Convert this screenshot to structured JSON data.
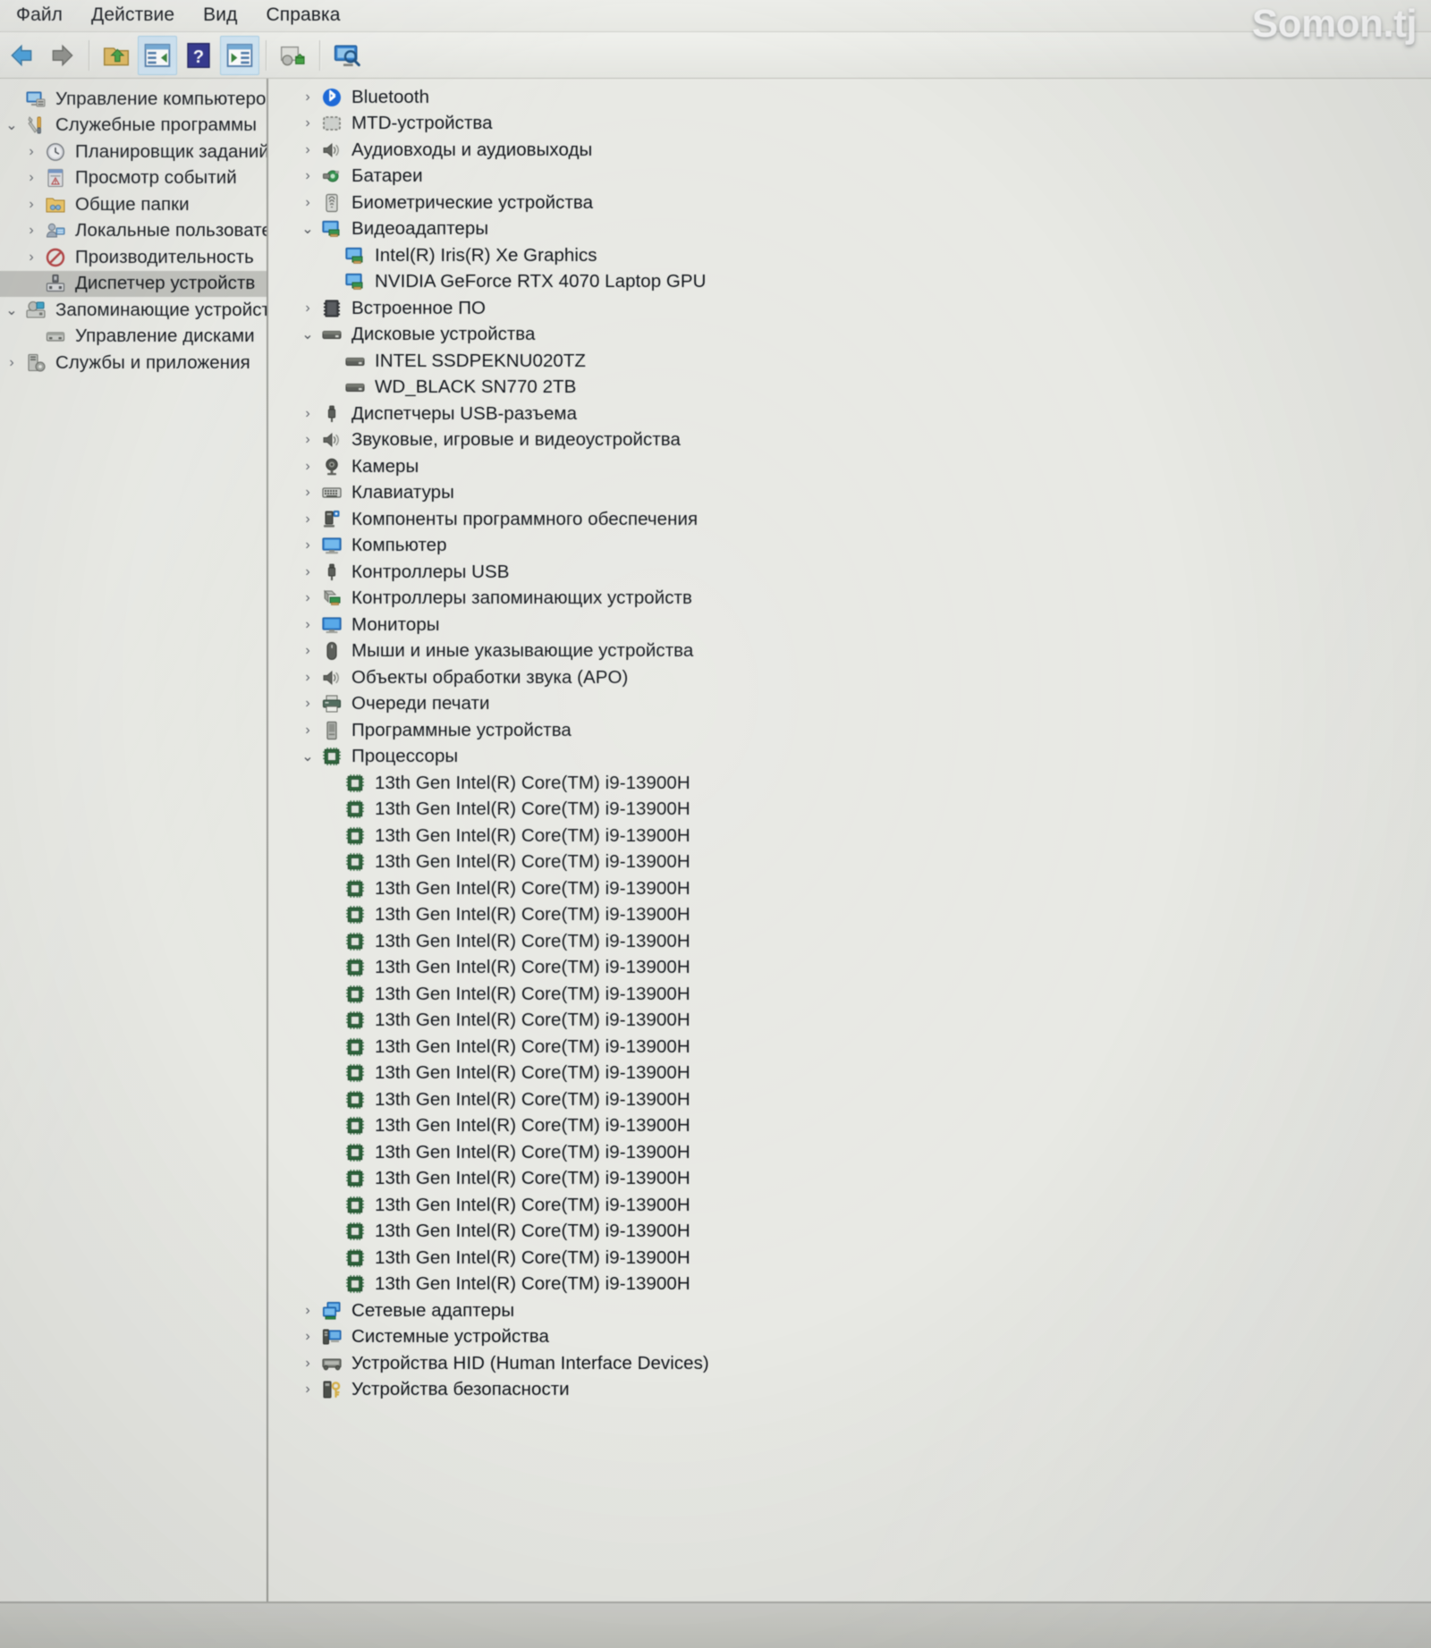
{
  "watermark": "Somon.tj",
  "menubar": {
    "items": [
      {
        "label": "Файл",
        "name": "menu-file"
      },
      {
        "label": "Действие",
        "name": "menu-action"
      },
      {
        "label": "Вид",
        "name": "menu-view"
      },
      {
        "label": "Справка",
        "name": "menu-help"
      }
    ]
  },
  "toolbar": {
    "buttons": [
      {
        "name": "back-button",
        "icon": "arrow-left-icon",
        "active": false
      },
      {
        "name": "forward-button",
        "icon": "arrow-right-icon",
        "active": false
      },
      {
        "name": "up-folder-button",
        "icon": "folder-up-icon",
        "active": false
      },
      {
        "name": "show-hide-console-tree-button",
        "icon": "console-tree-icon",
        "active": true
      },
      {
        "name": "help-button",
        "icon": "question-mark-icon",
        "active": false
      },
      {
        "name": "show-hide-action-pane-button",
        "icon": "action-pane-icon",
        "active": true
      },
      {
        "name": "update-driver-button",
        "icon": "driver-update-icon",
        "active": false
      },
      {
        "name": "scan-hardware-changes-button",
        "icon": "scan-monitor-icon",
        "active": false
      }
    ]
  },
  "sidebar": {
    "items": [
      {
        "label": "Управление компьютером (лс",
        "indent": 0,
        "chevron": "none",
        "icon": "computer-management-icon",
        "selected": false,
        "name": "sidebar-item-computer-management"
      },
      {
        "label": "Служебные программы",
        "indent": 0,
        "chevron": "open",
        "icon": "system-tools-icon",
        "selected": false,
        "name": "sidebar-item-system-tools"
      },
      {
        "label": "Планировщик заданий",
        "indent": 1,
        "chevron": "closed",
        "icon": "task-scheduler-icon",
        "selected": false,
        "name": "sidebar-item-task-scheduler"
      },
      {
        "label": "Просмотр событий",
        "indent": 1,
        "chevron": "closed",
        "icon": "event-viewer-icon",
        "selected": false,
        "name": "sidebar-item-event-viewer"
      },
      {
        "label": "Общие папки",
        "indent": 1,
        "chevron": "closed",
        "icon": "shared-folders-icon",
        "selected": false,
        "name": "sidebar-item-shared-folders"
      },
      {
        "label": "Локальные пользовате",
        "indent": 1,
        "chevron": "closed",
        "icon": "local-users-icon",
        "selected": false,
        "name": "sidebar-item-local-users-groups"
      },
      {
        "label": "Производительность",
        "indent": 1,
        "chevron": "closed",
        "icon": "performance-icon",
        "selected": false,
        "name": "sidebar-item-performance"
      },
      {
        "label": "Диспетчер устройств",
        "indent": 1,
        "chevron": "none",
        "icon": "device-manager-icon",
        "selected": true,
        "name": "sidebar-item-device-manager"
      },
      {
        "label": "Запоминающие устройств",
        "indent": 0,
        "chevron": "open",
        "icon": "storage-icon",
        "selected": false,
        "name": "sidebar-item-storage"
      },
      {
        "label": "Управление дисками",
        "indent": 1,
        "chevron": "none",
        "icon": "disk-management-icon",
        "selected": false,
        "name": "sidebar-item-disk-management"
      },
      {
        "label": "Службы и приложения",
        "indent": 0,
        "chevron": "closed",
        "icon": "services-apps-icon",
        "selected": false,
        "name": "sidebar-item-services-applications"
      }
    ]
  },
  "device_tree": {
    "items": [
      {
        "label": "Bluetooth",
        "indent": 1,
        "chevron": "closed",
        "icon": "bluetooth-icon",
        "name": "device-node-bluetooth"
      },
      {
        "label": "MTD-устройства",
        "indent": 1,
        "chevron": "closed",
        "icon": "mtd-device-icon",
        "name": "device-node-mtd"
      },
      {
        "label": "Аудиовходы и аудиовыходы",
        "indent": 1,
        "chevron": "closed",
        "icon": "speaker-icon",
        "name": "device-node-audio-inputs-outputs"
      },
      {
        "label": "Батареи",
        "indent": 1,
        "chevron": "closed",
        "icon": "battery-icon",
        "name": "device-node-batteries"
      },
      {
        "label": "Биометрические устройства",
        "indent": 1,
        "chevron": "closed",
        "icon": "fingerprint-icon",
        "name": "device-node-biometric"
      },
      {
        "label": "Видеоадаптеры",
        "indent": 1,
        "chevron": "open",
        "icon": "display-adapter-icon",
        "name": "device-node-display-adapters"
      },
      {
        "label": "Intel(R) Iris(R) Xe Graphics",
        "indent": 2,
        "chevron": "none",
        "icon": "display-adapter-icon",
        "name": "device-leaf-intel-iris-xe"
      },
      {
        "label": "NVIDIA GeForce RTX 4070 Laptop GPU",
        "indent": 2,
        "chevron": "none",
        "icon": "display-adapter-icon",
        "name": "device-leaf-nvidia-rtx-4070"
      },
      {
        "label": "Встроенное ПО",
        "indent": 1,
        "chevron": "closed",
        "icon": "firmware-icon",
        "name": "device-node-firmware"
      },
      {
        "label": "Дисковые устройства",
        "indent": 1,
        "chevron": "open",
        "icon": "disk-drive-icon",
        "name": "device-node-disk-drives"
      },
      {
        "label": "INTEL SSDPEKNU020TZ",
        "indent": 2,
        "chevron": "none",
        "icon": "disk-drive-icon",
        "name": "device-leaf-intel-ssd"
      },
      {
        "label": "WD_BLACK SN770 2TB",
        "indent": 2,
        "chevron": "none",
        "icon": "disk-drive-icon",
        "name": "device-leaf-wd-black-sn770"
      },
      {
        "label": "Диспетчеры USB-разъема",
        "indent": 1,
        "chevron": "closed",
        "icon": "usb-connector-icon",
        "name": "device-node-usb-connector-managers"
      },
      {
        "label": "Звуковые, игровые и видеоустройства",
        "indent": 1,
        "chevron": "closed",
        "icon": "speaker-icon",
        "name": "device-node-sound-video-game"
      },
      {
        "label": "Камеры",
        "indent": 1,
        "chevron": "closed",
        "icon": "camera-icon",
        "name": "device-node-cameras"
      },
      {
        "label": "Клавиатуры",
        "indent": 1,
        "chevron": "closed",
        "icon": "keyboard-icon",
        "name": "device-node-keyboards"
      },
      {
        "label": "Компоненты программного обеспечения",
        "indent": 1,
        "chevron": "closed",
        "icon": "software-component-icon",
        "name": "device-node-software-components"
      },
      {
        "label": "Компьютер",
        "indent": 1,
        "chevron": "closed",
        "icon": "computer-icon",
        "name": "device-node-computer"
      },
      {
        "label": "Контроллеры USB",
        "indent": 1,
        "chevron": "closed",
        "icon": "usb-connector-icon",
        "name": "device-node-usb-controllers"
      },
      {
        "label": "Контроллеры запоминающих устройств",
        "indent": 1,
        "chevron": "closed",
        "icon": "storage-controller-icon",
        "name": "device-node-storage-controllers"
      },
      {
        "label": "Мониторы",
        "indent": 1,
        "chevron": "closed",
        "icon": "monitor-icon",
        "name": "device-node-monitors"
      },
      {
        "label": "Мыши и иные указывающие устройства",
        "indent": 1,
        "chevron": "closed",
        "icon": "mouse-icon",
        "name": "device-node-mice-pointing"
      },
      {
        "label": "Объекты обработки звука (APO)",
        "indent": 1,
        "chevron": "closed",
        "icon": "speaker-icon",
        "name": "device-node-audio-processing-objects"
      },
      {
        "label": "Очереди печати",
        "indent": 1,
        "chevron": "closed",
        "icon": "printer-icon",
        "name": "device-node-print-queues"
      },
      {
        "label": "Программные устройства",
        "indent": 1,
        "chevron": "closed",
        "icon": "software-device-icon",
        "name": "device-node-software-devices"
      },
      {
        "label": "Процессоры",
        "indent": 1,
        "chevron": "open",
        "icon": "processor-icon",
        "name": "device-node-processors"
      },
      {
        "label": "13th Gen Intel(R) Core(TM) i9-13900H",
        "indent": 2,
        "chevron": "none",
        "icon": "processor-icon",
        "name": "device-leaf-cpu-1"
      },
      {
        "label": "13th Gen Intel(R) Core(TM) i9-13900H",
        "indent": 2,
        "chevron": "none",
        "icon": "processor-icon",
        "name": "device-leaf-cpu-2"
      },
      {
        "label": "13th Gen Intel(R) Core(TM) i9-13900H",
        "indent": 2,
        "chevron": "none",
        "icon": "processor-icon",
        "name": "device-leaf-cpu-3"
      },
      {
        "label": "13th Gen Intel(R) Core(TM) i9-13900H",
        "indent": 2,
        "chevron": "none",
        "icon": "processor-icon",
        "name": "device-leaf-cpu-4"
      },
      {
        "label": "13th Gen Intel(R) Core(TM) i9-13900H",
        "indent": 2,
        "chevron": "none",
        "icon": "processor-icon",
        "name": "device-leaf-cpu-5"
      },
      {
        "label": "13th Gen Intel(R) Core(TM) i9-13900H",
        "indent": 2,
        "chevron": "none",
        "icon": "processor-icon",
        "name": "device-leaf-cpu-6"
      },
      {
        "label": "13th Gen Intel(R) Core(TM) i9-13900H",
        "indent": 2,
        "chevron": "none",
        "icon": "processor-icon",
        "name": "device-leaf-cpu-7"
      },
      {
        "label": "13th Gen Intel(R) Core(TM) i9-13900H",
        "indent": 2,
        "chevron": "none",
        "icon": "processor-icon",
        "name": "device-leaf-cpu-8"
      },
      {
        "label": "13th Gen Intel(R) Core(TM) i9-13900H",
        "indent": 2,
        "chevron": "none",
        "icon": "processor-icon",
        "name": "device-leaf-cpu-9"
      },
      {
        "label": "13th Gen Intel(R) Core(TM) i9-13900H",
        "indent": 2,
        "chevron": "none",
        "icon": "processor-icon",
        "name": "device-leaf-cpu-10"
      },
      {
        "label": "13th Gen Intel(R) Core(TM) i9-13900H",
        "indent": 2,
        "chevron": "none",
        "icon": "processor-icon",
        "name": "device-leaf-cpu-11"
      },
      {
        "label": "13th Gen Intel(R) Core(TM) i9-13900H",
        "indent": 2,
        "chevron": "none",
        "icon": "processor-icon",
        "name": "device-leaf-cpu-12"
      },
      {
        "label": "13th Gen Intel(R) Core(TM) i9-13900H",
        "indent": 2,
        "chevron": "none",
        "icon": "processor-icon",
        "name": "device-leaf-cpu-13"
      },
      {
        "label": "13th Gen Intel(R) Core(TM) i9-13900H",
        "indent": 2,
        "chevron": "none",
        "icon": "processor-icon",
        "name": "device-leaf-cpu-14"
      },
      {
        "label": "13th Gen Intel(R) Core(TM) i9-13900H",
        "indent": 2,
        "chevron": "none",
        "icon": "processor-icon",
        "name": "device-leaf-cpu-15"
      },
      {
        "label": "13th Gen Intel(R) Core(TM) i9-13900H",
        "indent": 2,
        "chevron": "none",
        "icon": "processor-icon",
        "name": "device-leaf-cpu-16"
      },
      {
        "label": "13th Gen Intel(R) Core(TM) i9-13900H",
        "indent": 2,
        "chevron": "none",
        "icon": "processor-icon",
        "name": "device-leaf-cpu-17"
      },
      {
        "label": "13th Gen Intel(R) Core(TM) i9-13900H",
        "indent": 2,
        "chevron": "none",
        "icon": "processor-icon",
        "name": "device-leaf-cpu-18"
      },
      {
        "label": "13th Gen Intel(R) Core(TM) i9-13900H",
        "indent": 2,
        "chevron": "none",
        "icon": "processor-icon",
        "name": "device-leaf-cpu-19"
      },
      {
        "label": "13th Gen Intel(R) Core(TM) i9-13900H",
        "indent": 2,
        "chevron": "none",
        "icon": "processor-icon",
        "name": "device-leaf-cpu-20"
      },
      {
        "label": "Сетевые адаптеры",
        "indent": 1,
        "chevron": "closed",
        "icon": "network-adapter-icon",
        "name": "device-node-network-adapters"
      },
      {
        "label": "Системные устройства",
        "indent": 1,
        "chevron": "closed",
        "icon": "system-device-icon",
        "name": "device-node-system-devices"
      },
      {
        "label": "Устройства HID (Human Interface Devices)",
        "indent": 1,
        "chevron": "closed",
        "icon": "hid-device-icon",
        "name": "device-node-hid"
      },
      {
        "label": "Устройства безопасности",
        "indent": 1,
        "chevron": "closed",
        "icon": "security-device-icon",
        "name": "device-node-security-devices"
      }
    ]
  },
  "colors": {
    "selection": "#bdbeb9",
    "accent_blue": "#2f7fd0",
    "window_bg": "#e8e9e4"
  }
}
